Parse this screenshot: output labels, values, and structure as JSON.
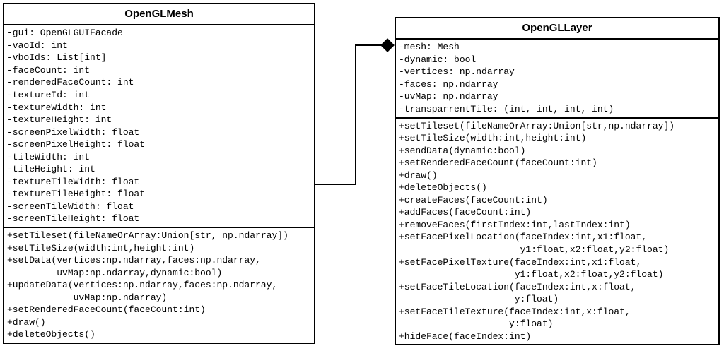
{
  "classes": {
    "mesh": {
      "name": "OpenGLMesh",
      "attrs": [
        "-gui: OpenGLGUIFacade",
        "-vaoId: int",
        "-vboIds: List[int]",
        "-faceCount: int",
        "-renderedFaceCount: int",
        "-textureId: int",
        "-textureWidth: int",
        "-textureHeight: int",
        "-screenPixelWidth: float",
        "-screenPixelHeight: float",
        "-tileWidth: int",
        "-tileHeight: int",
        "-textureTileWidth: float",
        "-textureTileHeight: float",
        "-screenTileWidth: float",
        "-screenTileHeight: float"
      ],
      "ops": [
        "+setTileset(fileNameOrArray:Union[str, np.ndarray])",
        "+setTileSize(width:int,height:int)",
        "+setData(vertices:np.ndarray,faces:np.ndarray,",
        "         uvMap:np.ndarray,dynamic:bool)",
        "+updateData(vertices:np.ndarray,faces:np.ndarray,",
        "            uvMap:np.ndarray)",
        "+setRenderedFaceCount(faceCount:int)",
        "+draw()",
        "+deleteObjects()"
      ]
    },
    "layer": {
      "name": "OpenGLLayer",
      "attrs": [
        "-mesh: Mesh",
        "-dynamic: bool",
        "-vertices: np.ndarray",
        "-faces: np.ndarray",
        "-uvMap: np.ndarray",
        "-transparrentTile: (int, int, int, int)"
      ],
      "ops": [
        "+setTileset(fileNameOrArray:Union[str,np.ndarray])",
        "+setTileSize(width:int,height:int)",
        "+sendData(dynamic:bool)",
        "+setRenderedFaceCount(faceCount:int)",
        "+draw()",
        "+deleteObjects()",
        "+createFaces(faceCount:int)",
        "+addFaces(faceCount:int)",
        "+removeFaces(firstIndex:int,lastIndex:int)",
        "+setFacePixelLocation(faceIndex:int,x1:float,",
        "                      y1:float,x2:float,y2:float)",
        "+setFacePixelTexture(faceIndex:int,x1:float,",
        "                     y1:float,x2:float,y2:float)",
        "+setFaceTileLocation(faceIndex:int,x:float,",
        "                     y:float)",
        "+setFaceTileTexture(faceIndex:int,x:float,",
        "                    y:float)",
        "+hideFace(faceIndex:int)"
      ]
    }
  },
  "chart_data": {
    "type": "uml-class-diagram",
    "classes": [
      {
        "id": "mesh",
        "name": "OpenGLMesh"
      },
      {
        "id": "layer",
        "name": "OpenGLLayer"
      }
    ],
    "relations": [
      {
        "from": "layer",
        "to": "mesh",
        "kind": "composition",
        "diamond_at": "layer"
      }
    ]
  }
}
